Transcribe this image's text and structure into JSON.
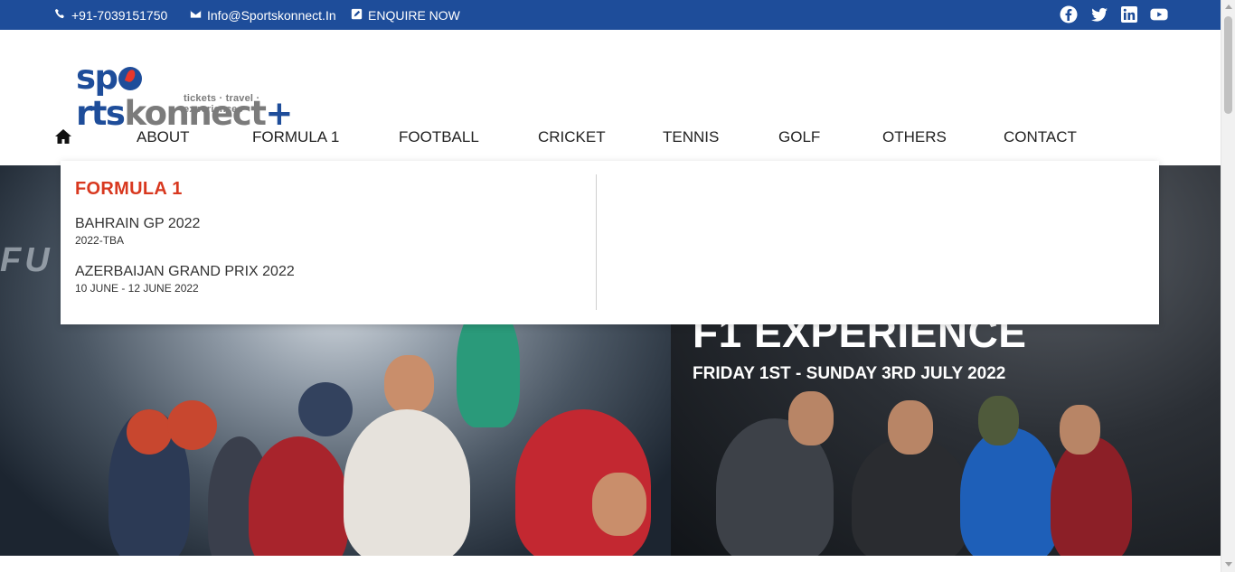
{
  "topbar": {
    "phone": "+91-7039151750",
    "email": "Info@Sportskonnect.In",
    "enquire": "ENQUIRE NOW",
    "phone_icon": "phone-icon",
    "email_icon": "envelope-icon",
    "enquire_icon": "edit-icon",
    "social": [
      "facebook-icon",
      "twitter-icon",
      "linkedin-icon",
      "youtube-icon"
    ],
    "bg_color": "#1e4d9a"
  },
  "logo": {
    "tagline": "tickets · travel · experiences"
  },
  "nav": {
    "home_icon": "home-icon",
    "items": [
      "ABOUT",
      "FORMULA 1",
      "FOOTBALL",
      "CRICKET",
      "TENNIS",
      "GOLF",
      "OTHERS",
      "CONTACT"
    ]
  },
  "dropdown": {
    "heading": "FORMULA 1",
    "heading_color": "#d8381f",
    "events": [
      {
        "name": "BAHRAIN GP 2022",
        "date": "2022-TBA"
      },
      {
        "name": "AZERBAIJAN GRAND PRIX 2022",
        "date": "10 JUNE - 12 JUNE 2022"
      }
    ]
  },
  "hero": {
    "title": "F1 EXPERIENCE",
    "date": "FRIDAY 1ST - SUNDAY 3RD JULY 2022",
    "bg_text": "FU"
  }
}
